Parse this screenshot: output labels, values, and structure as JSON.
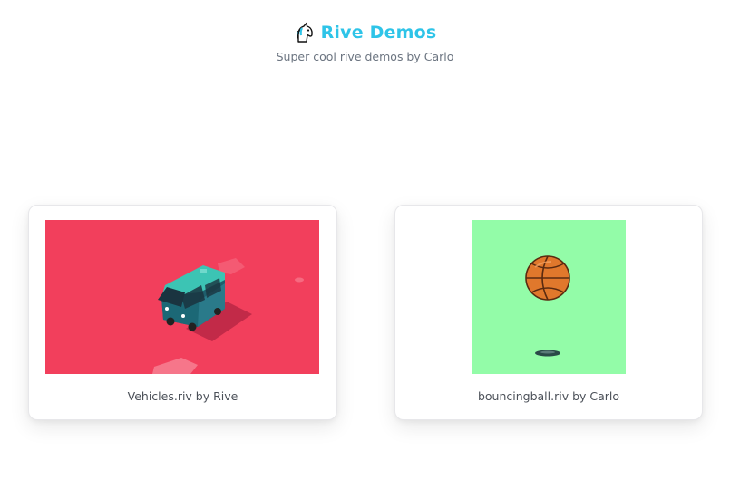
{
  "header": {
    "logo_icon": "unicorn-icon",
    "title": "Rive Demos",
    "subtitle": "Super cool rive demos by Carlo"
  },
  "cards": [
    {
      "caption": "Vehicles.riv by Rive",
      "background": "#f23f5c",
      "content_icon": "van-icon"
    },
    {
      "caption": "bouncingball.riv by Carlo",
      "background": "#93fca8",
      "content_icon": "basketball-icon"
    }
  ],
  "colors": {
    "accent": "#2ec4e8",
    "subtitle": "#6b7480",
    "caption": "#4b5058"
  }
}
